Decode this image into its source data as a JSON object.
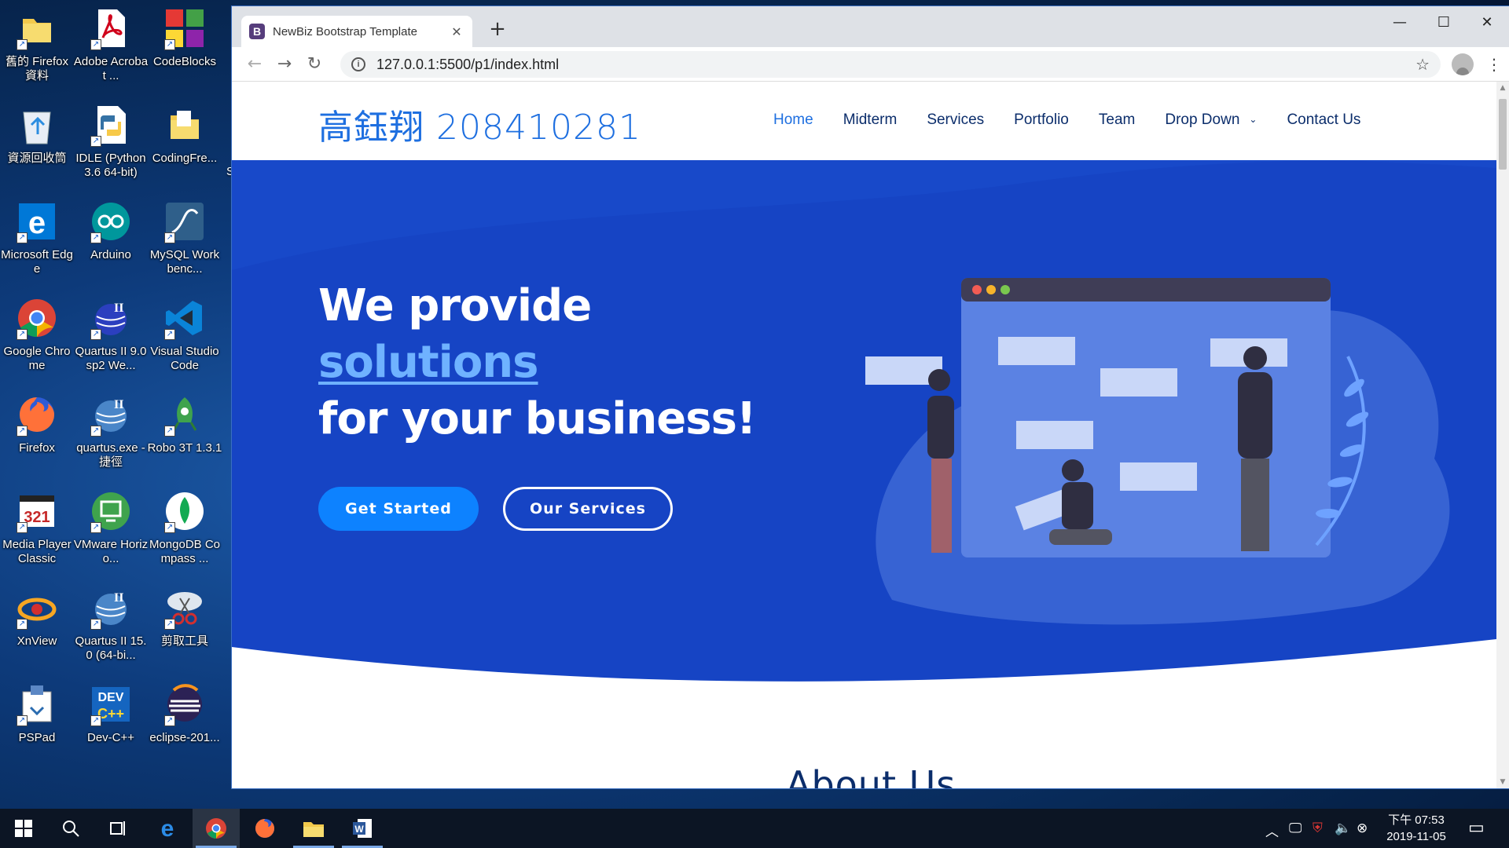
{
  "desktop": {
    "icons": [
      {
        "label": "舊的 Firefox 資料",
        "icon": "folder-icon"
      },
      {
        "label": "Adobe Acrobat ...",
        "icon": "acrobat-icon"
      },
      {
        "label": "CodeBlocks",
        "icon": "codeblocks-icon"
      },
      {
        "label": "資源回收筒",
        "icon": "recycle-bin-icon"
      },
      {
        "label": "IDLE (Python 3.6 64-bit)",
        "icon": "python-icon"
      },
      {
        "label": "CodingFre...",
        "icon": "folder-icon"
      },
      {
        "label": "Microsoft Edge",
        "icon": "edge-icon"
      },
      {
        "label": "Arduino",
        "icon": "arduino-icon"
      },
      {
        "label": "MySQL Workbenc...",
        "icon": "mysql-icon"
      },
      {
        "label": "Google Chrome",
        "icon": "chrome-icon"
      },
      {
        "label": "Quartus II 9.0sp2 We...",
        "icon": "quartus-icon"
      },
      {
        "label": "Visual Studio Code",
        "icon": "vscode-icon"
      },
      {
        "label": "Firefox",
        "icon": "firefox-icon"
      },
      {
        "label": "quartus.exe - 捷徑",
        "icon": "quartus-icon"
      },
      {
        "label": "Robo 3T 1.3.1",
        "icon": "robo3t-icon"
      },
      {
        "label": "Media Player Classic",
        "icon": "media-player-icon"
      },
      {
        "label": "VMware Horizo...",
        "icon": "vmware-icon"
      },
      {
        "label": "MongoDB Compass ...",
        "icon": "mongodb-icon"
      },
      {
        "label": "XnView",
        "icon": "xnview-icon"
      },
      {
        "label": "Quartus II 15.0 (64-bi...",
        "icon": "quartus-icon"
      },
      {
        "label": "剪取工具",
        "icon": "snipping-tool-icon"
      },
      {
        "label": "PSPad",
        "icon": "pspad-icon"
      },
      {
        "label": "Dev-C++",
        "icon": "devcpp-icon"
      },
      {
        "label": "eclipse-201...",
        "icon": "eclipse-icon"
      }
    ],
    "partial_label": "S"
  },
  "browser": {
    "tab_title": "NewBiz Bootstrap Template",
    "favicon_letter": "B",
    "url": "127.0.0.1:5500/p1/index.html"
  },
  "site": {
    "logo": "高鈺翔 208410281",
    "nav": [
      "Home",
      "Midterm",
      "Services",
      "Portfolio",
      "Team",
      "Drop Down",
      "Contact Us"
    ],
    "hero": {
      "line1": "We provide",
      "highlight": "solutions",
      "line3": "for your business!",
      "primary_button": "Get Started",
      "secondary_button": "Our Services"
    },
    "next_section_title": "About Us"
  },
  "taskbar": {
    "time": "下午 07:53",
    "date": "2019-11-05"
  },
  "colors": {
    "accent": "#1e6fe0",
    "hero_bg": "#1644c4",
    "button_primary": "#0d82ff",
    "nav_text": "#0b2d6b"
  }
}
